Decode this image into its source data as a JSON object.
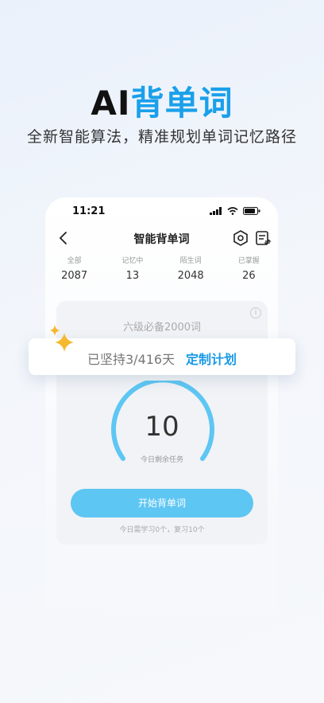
{
  "hero": {
    "title_prefix": "AI",
    "title_accent": "背单词",
    "subtitle": "全新智能算法，精准规划单词记忆路径"
  },
  "status_bar": {
    "time": "11:21"
  },
  "navbar": {
    "title": "智能背单词"
  },
  "stats": [
    {
      "label": "全部",
      "value": "2087"
    },
    {
      "label": "记忆中",
      "value": "13"
    },
    {
      "label": "陌生词",
      "value": "2048"
    },
    {
      "label": "已掌握",
      "value": "26"
    }
  ],
  "card": {
    "book_title": "六级必备2000词",
    "info_icon": "i",
    "remaining": "10",
    "remaining_label": "今日剩余任务",
    "start_button": "开始背单词",
    "today_note": "今日需学习0个，复习10个"
  },
  "overlay": {
    "streak_text": "已坚持3/416天",
    "custom_plan_link": "定制计划"
  },
  "colors": {
    "accent": "#1aa0ea",
    "button": "#5ec6f3",
    "gauge": "#5ec6f3"
  }
}
